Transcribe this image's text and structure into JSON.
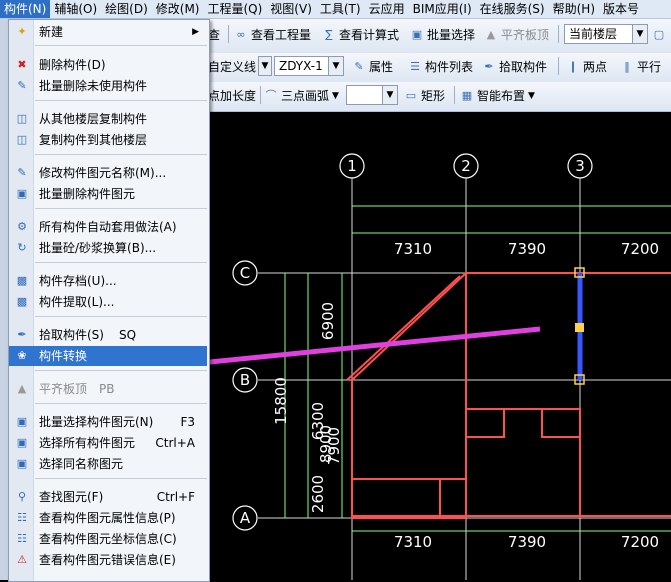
{
  "menubar": {
    "items": [
      "构件(N)",
      "辅轴(O)",
      "绘图(D)",
      "修改(M)",
      "工程量(Q)",
      "视图(V)",
      "工具(T)",
      "云应用",
      "BIM应用(I)",
      "在线服务(S)",
      "帮助(H)",
      "版本号"
    ]
  },
  "toolbar1": {
    "btn_find": "查",
    "btn_view_quantity": "查看工程量",
    "btn_view_formula": "查看计算式",
    "btn_batch_select": "批量选择",
    "btn_align_top": "平齐板顶",
    "floor_select": "当前楼层"
  },
  "toolbar2": {
    "custom_line": "自定义线",
    "type_select": "ZDYX-1",
    "btn_properties": "属性",
    "btn_component_list": "构件列表",
    "btn_pick_component": "拾取构件",
    "btn_two_points": "两点",
    "btn_parallel": "平行"
  },
  "toolbar3": {
    "point_extend": "点加长度",
    "three_point_arc": "三点画弧",
    "btn_rect": "矩形",
    "btn_smart_layout": "智能布置"
  },
  "menu": {
    "items": [
      {
        "label": "新建",
        "shortcut": "",
        "icon": "new-icon",
        "submenu": true
      },
      {
        "label": "删除构件(D)",
        "shortcut": "",
        "icon": "delete-icon"
      },
      {
        "label": "批量删除未使用构件",
        "shortcut": "",
        "icon": "batch-delete-icon"
      },
      {
        "label": "从其他楼层复制构件",
        "shortcut": "",
        "icon": "copy-from-floor-icon"
      },
      {
        "label": "复制构件到其他楼层",
        "shortcut": "",
        "icon": "copy-to-floor-icon"
      },
      {
        "label": "修改构件图元名称(M)...",
        "shortcut": "",
        "icon": "rename-icon"
      },
      {
        "label": "批量删除构件图元",
        "shortcut": "",
        "icon": "batch-delete-elements-icon"
      },
      {
        "label": "所有构件自动套用做法(A)",
        "shortcut": "",
        "icon": "auto-apply-icon"
      },
      {
        "label": "批量砼/砂浆换算(B)...",
        "shortcut": "",
        "icon": "concrete-convert-icon"
      },
      {
        "label": "构件存档(U)...",
        "shortcut": "",
        "icon": "archive-icon"
      },
      {
        "label": "构件提取(L)...",
        "shortcut": "",
        "icon": "extract-icon"
      },
      {
        "label": "拾取构件(S)",
        "shortcut": "SQ",
        "icon": "pick-icon"
      },
      {
        "label": "构件转换",
        "shortcut": "",
        "icon": "convert-icon",
        "highlight": true
      },
      {
        "label": "平齐板顶",
        "shortcut": "PB",
        "icon": "align-top-icon",
        "disabled": true
      },
      {
        "label": "批量选择构件图元(N)",
        "shortcut": "F3",
        "icon": "batch-select-icon"
      },
      {
        "label": "选择所有构件图元",
        "shortcut": "Ctrl+A",
        "icon": "select-all-icon"
      },
      {
        "label": "选择同名称图元",
        "shortcut": "",
        "icon": "select-same-icon"
      },
      {
        "label": "查找图元(F)",
        "shortcut": "Ctrl+F",
        "icon": "find-icon"
      },
      {
        "label": "查看构件图元属性信息(P)",
        "shortcut": "",
        "icon": "properties-info-icon"
      },
      {
        "label": "查看构件图元坐标信息(C)",
        "shortcut": "",
        "icon": "coordinates-info-icon"
      },
      {
        "label": "查看构件图元错误信息(E)",
        "shortcut": "",
        "icon": "error-info-icon"
      }
    ]
  },
  "drawing": {
    "axis_top": [
      "1",
      "2",
      "3"
    ],
    "axis_left": [
      "C",
      "B",
      "A"
    ],
    "dims_top": [
      "7310",
      "7390",
      "7200"
    ],
    "dims_bottom": [
      "7310",
      "7390",
      "7200"
    ],
    "dims_vertical": [
      "6900",
      "15800",
      "6300",
      "8900",
      "7900",
      "2600"
    ],
    "colors": {
      "grid": "#ffffff",
      "walls": "#ff5050",
      "axis": "#ff3030",
      "dim": "#7fff7f",
      "selected": "#3a56ff",
      "arrow": "#e040e0"
    }
  }
}
